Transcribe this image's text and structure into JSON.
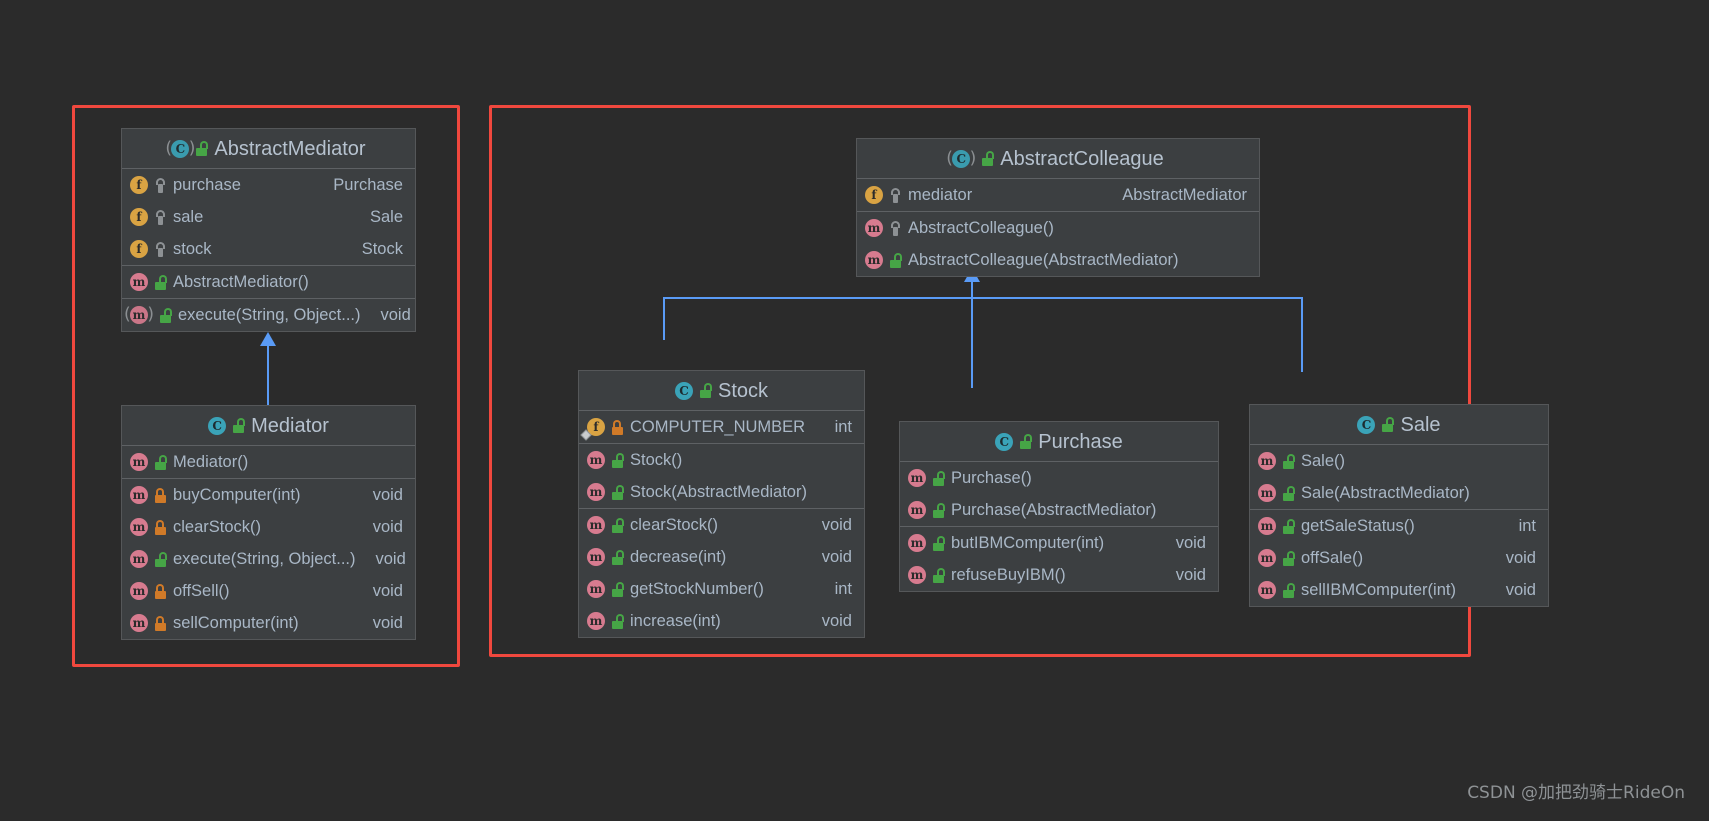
{
  "diagram": {
    "title": "Mediator Pattern UML Class Diagram",
    "background_color": "#2b2b2b",
    "group_border_color": "#f0483e",
    "connector_color": "#5a9bf6",
    "class_box_bg": "#3c3f41",
    "text_color": "#a9b7c6"
  },
  "groups": [
    {
      "name": "mediator-group"
    },
    {
      "name": "colleague-group"
    }
  ],
  "classes": {
    "abstract_mediator": {
      "name": "AbstractMediator",
      "kind_icon": "abstract-class-icon",
      "visibility_icon": "public-lock-icon",
      "sections": [
        {
          "members": [
            {
              "icon": "field-icon",
              "visibility": "protected-icon",
              "name": "purchase",
              "type": "Purchase",
              "abstract": false,
              "static": false
            },
            {
              "icon": "field-icon",
              "visibility": "protected-icon",
              "name": "sale",
              "type": "Sale",
              "abstract": false,
              "static": false
            },
            {
              "icon": "field-icon",
              "visibility": "protected-icon",
              "name": "stock",
              "type": "Stock",
              "abstract": false,
              "static": false
            }
          ]
        },
        {
          "members": [
            {
              "icon": "method-icon",
              "visibility": "public-lock-icon",
              "name": "AbstractMediator()",
              "type": "",
              "abstract": false,
              "static": false
            }
          ]
        },
        {
          "members": [
            {
              "icon": "method-icon",
              "visibility": "public-lock-icon",
              "name": "execute(String, Object...)",
              "type": "void",
              "abstract": true,
              "static": false
            }
          ]
        }
      ]
    },
    "mediator": {
      "name": "Mediator",
      "kind_icon": "class-icon",
      "visibility_icon": "public-lock-icon",
      "sections": [
        {
          "members": [
            {
              "icon": "method-icon",
              "visibility": "public-lock-icon",
              "name": "Mediator()",
              "type": "",
              "abstract": false,
              "static": false
            }
          ]
        },
        {
          "members": [
            {
              "icon": "method-icon",
              "visibility": "private-lock-icon",
              "name": "buyComputer(int)",
              "type": "void",
              "abstract": false,
              "static": false
            },
            {
              "icon": "method-icon",
              "visibility": "private-lock-icon",
              "name": "clearStock()",
              "type": "void",
              "abstract": false,
              "static": false
            },
            {
              "icon": "method-icon",
              "visibility": "public-lock-icon",
              "name": "execute(String, Object...)",
              "type": "void",
              "abstract": false,
              "static": false
            },
            {
              "icon": "method-icon",
              "visibility": "private-lock-icon",
              "name": "offSell()",
              "type": "void",
              "abstract": false,
              "static": false
            },
            {
              "icon": "method-icon",
              "visibility": "private-lock-icon",
              "name": "sellComputer(int)",
              "type": "void",
              "abstract": false,
              "static": false
            }
          ]
        }
      ]
    },
    "abstract_colleague": {
      "name": "AbstractColleague",
      "kind_icon": "abstract-class-icon",
      "visibility_icon": "public-lock-icon",
      "sections": [
        {
          "members": [
            {
              "icon": "field-icon",
              "visibility": "protected-icon",
              "name": "mediator",
              "type": "AbstractMediator",
              "abstract": false,
              "static": false
            }
          ]
        },
        {
          "members": [
            {
              "icon": "method-icon",
              "visibility": "protected-icon",
              "name": "AbstractColleague()",
              "type": "",
              "abstract": false,
              "static": false
            },
            {
              "icon": "method-icon",
              "visibility": "public-lock-icon",
              "name": "AbstractColleague(AbstractMediator)",
              "type": "",
              "abstract": false,
              "static": false
            }
          ]
        }
      ]
    },
    "stock": {
      "name": "Stock",
      "kind_icon": "class-icon",
      "visibility_icon": "public-lock-icon",
      "sections": [
        {
          "members": [
            {
              "icon": "field-icon",
              "visibility": "private-lock-icon",
              "name": "COMPUTER_NUMBER",
              "type": "int",
              "abstract": false,
              "static": true
            }
          ]
        },
        {
          "members": [
            {
              "icon": "method-icon",
              "visibility": "public-lock-icon",
              "name": "Stock()",
              "type": "",
              "abstract": false,
              "static": false
            },
            {
              "icon": "method-icon",
              "visibility": "public-lock-icon",
              "name": "Stock(AbstractMediator)",
              "type": "",
              "abstract": false,
              "static": false
            }
          ]
        },
        {
          "members": [
            {
              "icon": "method-icon",
              "visibility": "public-lock-icon",
              "name": "clearStock()",
              "type": "void",
              "abstract": false,
              "static": false
            },
            {
              "icon": "method-icon",
              "visibility": "public-lock-icon",
              "name": "decrease(int)",
              "type": "void",
              "abstract": false,
              "static": false
            },
            {
              "icon": "method-icon",
              "visibility": "public-lock-icon",
              "name": "getStockNumber()",
              "type": "int",
              "abstract": false,
              "static": false
            },
            {
              "icon": "method-icon",
              "visibility": "public-lock-icon",
              "name": "increase(int)",
              "type": "void",
              "abstract": false,
              "static": false
            }
          ]
        }
      ]
    },
    "purchase": {
      "name": "Purchase",
      "kind_icon": "class-icon",
      "visibility_icon": "public-lock-icon",
      "sections": [
        {
          "members": [
            {
              "icon": "method-icon",
              "visibility": "public-lock-icon",
              "name": "Purchase()",
              "type": "",
              "abstract": false,
              "static": false
            },
            {
              "icon": "method-icon",
              "visibility": "public-lock-icon",
              "name": "Purchase(AbstractMediator)",
              "type": "",
              "abstract": false,
              "static": false
            }
          ]
        },
        {
          "members": [
            {
              "icon": "method-icon",
              "visibility": "public-lock-icon",
              "name": "butIBMComputer(int)",
              "type": "void",
              "abstract": false,
              "static": false
            },
            {
              "icon": "method-icon",
              "visibility": "public-lock-icon",
              "name": "refuseBuyIBM()",
              "type": "void",
              "abstract": false,
              "static": false
            }
          ]
        }
      ]
    },
    "sale": {
      "name": "Sale",
      "kind_icon": "class-icon",
      "visibility_icon": "public-lock-icon",
      "sections": [
        {
          "members": [
            {
              "icon": "method-icon",
              "visibility": "public-lock-icon",
              "name": "Sale()",
              "type": "",
              "abstract": false,
              "static": false
            },
            {
              "icon": "method-icon",
              "visibility": "public-lock-icon",
              "name": "Sale(AbstractMediator)",
              "type": "",
              "abstract": false,
              "static": false
            }
          ]
        },
        {
          "members": [
            {
              "icon": "method-icon",
              "visibility": "public-lock-icon",
              "name": "getSaleStatus()",
              "type": "int",
              "abstract": false,
              "static": false
            },
            {
              "icon": "method-icon",
              "visibility": "public-lock-icon",
              "name": "offSale()",
              "type": "void",
              "abstract": false,
              "static": false
            },
            {
              "icon": "method-icon",
              "visibility": "public-lock-icon",
              "name": "sellIBMComputer(int)",
              "type": "void",
              "abstract": false,
              "static": false
            }
          ]
        }
      ]
    }
  },
  "watermark": "CSDN @加把劲骑士RideOn"
}
